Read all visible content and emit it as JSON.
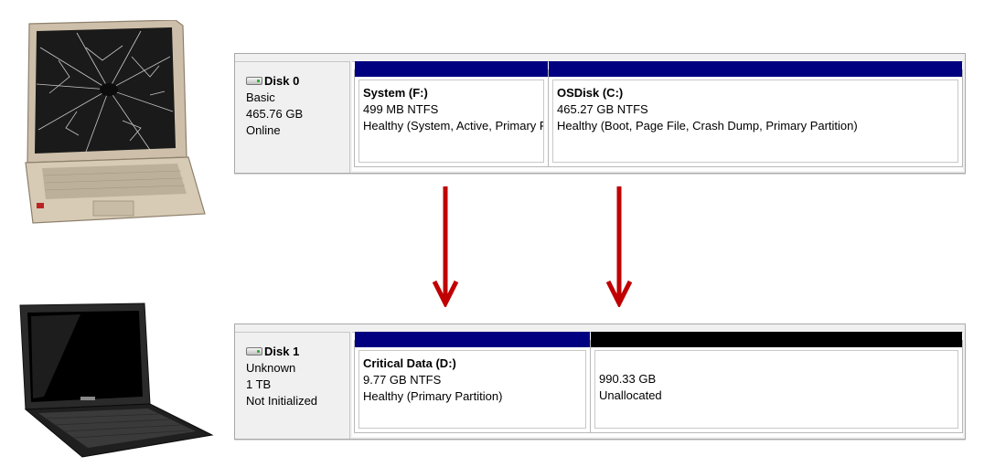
{
  "disks": [
    {
      "title": "Disk 0",
      "type": "Basic",
      "size": "465.76 GB",
      "status": "Online",
      "partitions": [
        {
          "name": "System  (F:)",
          "detail": "499 MB NTFS",
          "status": "Healthy (System, Active, Primary Partition)",
          "bar_color": "#000080"
        },
        {
          "name": "OSDisk  (C:)",
          "detail": "465.27 GB NTFS",
          "status": "Healthy (Boot, Page File, Crash Dump, Primary Partition)",
          "bar_color": "#000080"
        }
      ]
    },
    {
      "title": "Disk 1",
      "type": "Unknown",
      "size": "1 TB",
      "status": "Not Initialized",
      "partitions": [
        {
          "name": "Critical Data  (D:)",
          "detail": "9.77 GB NTFS",
          "status": "Healthy (Primary Partition)",
          "bar_color": "#000080"
        },
        {
          "size": "990.33 GB",
          "status": "Unallocated",
          "bar_color": "#000000"
        }
      ]
    }
  ],
  "arrow_color": "#c00000",
  "icons": {
    "old_laptop": "broken-laptop-icon",
    "new_laptop": "laptop-icon",
    "disk": "hard-disk-icon",
    "arrow": "arrow-down-icon"
  }
}
